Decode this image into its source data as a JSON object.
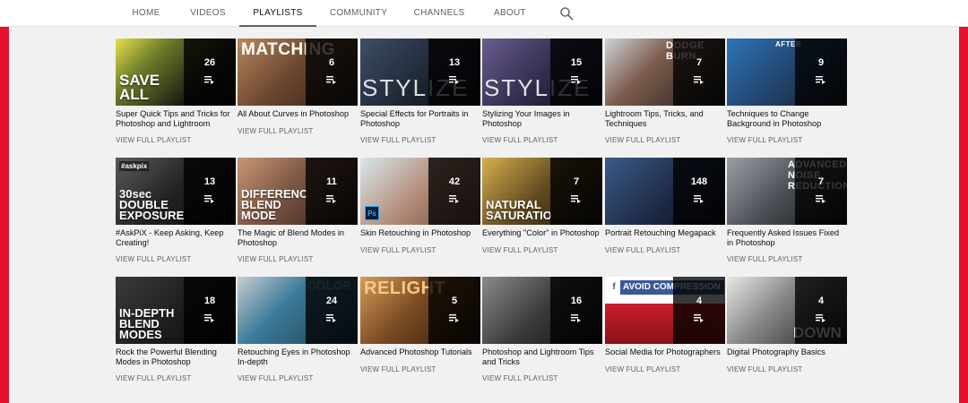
{
  "tabs": [
    {
      "label": "HOME",
      "active": false
    },
    {
      "label": "VIDEOS",
      "active": false
    },
    {
      "label": "PLAYLISTS",
      "active": true
    },
    {
      "label": "COMMUNITY",
      "active": false
    },
    {
      "label": "CHANNELS",
      "active": false
    },
    {
      "label": "ABOUT",
      "active": false
    }
  ],
  "search_icon": "search-icon",
  "view_full_label": "VIEW FULL PLAYLIST",
  "accent_color": "#e8102f",
  "playlists": [
    {
      "title": "Super Quick Tips and Tricks for Photoshop and Lightroom",
      "count": "26",
      "thumb_text": "SAVE ALL"
    },
    {
      "title": "All About Curves in Photoshop",
      "count": "6",
      "thumb_text": "MATCHING"
    },
    {
      "title": "Special Effects for Portraits in Photoshop",
      "count": "13",
      "thumb_text": "STYLIZE"
    },
    {
      "title": "Stylizing Your Images in Photoshop",
      "count": "15",
      "thumb_text": "STYLIZE"
    },
    {
      "title": "Lightroom Tips, Tricks, and Techniques",
      "count": "7",
      "thumb_text": "DODGE BURN"
    },
    {
      "title": "Techniques to Change Background in Photoshop",
      "count": "9",
      "thumb_text": "AFTER"
    },
    {
      "title": "#AskPiX - Keep Asking, Keep Creating!",
      "count": "13",
      "thumb_text": "30sec DOUBLE EXPOSURE",
      "tag": "#askpix"
    },
    {
      "title": "The Magic of Blend Modes in Photoshop",
      "count": "11",
      "thumb_text": "DIFFERENCE BLEND MODE"
    },
    {
      "title": "Skin Retouching in Photoshop",
      "count": "42",
      "thumb_text": "",
      "badge": "Ps"
    },
    {
      "title": "Everything \"Color\" in Photoshop",
      "count": "7",
      "thumb_text": "NATURAL SATURATION"
    },
    {
      "title": "Portrait Retouching Megapack",
      "count": "148",
      "thumb_text": ""
    },
    {
      "title": "Frequently Asked Issues Fixed in Photoshop",
      "count": "7",
      "thumb_text": "ADVANCED NOISE REDUCTION"
    },
    {
      "title": "Rock the Powerful Blending Modes in Photoshop",
      "count": "18",
      "thumb_text": "IN-DEPTH BLEND MODES"
    },
    {
      "title": "Retouching Eyes in Photoshop In-depth",
      "count": "24",
      "thumb_text": "COLOR"
    },
    {
      "title": "Advanced Photoshop Tutorials",
      "count": "5",
      "thumb_text": "RELIGHT"
    },
    {
      "title": "Photoshop and Lightroom Tips and Tricks",
      "count": "16",
      "thumb_text": ""
    },
    {
      "title": "Social Media for Photographers",
      "count": "4",
      "thumb_text": "AVOID COMPRESSION",
      "fb": "f"
    },
    {
      "title": "Digital Photography Basics",
      "count": "4",
      "thumb_text": "DOWN"
    }
  ]
}
